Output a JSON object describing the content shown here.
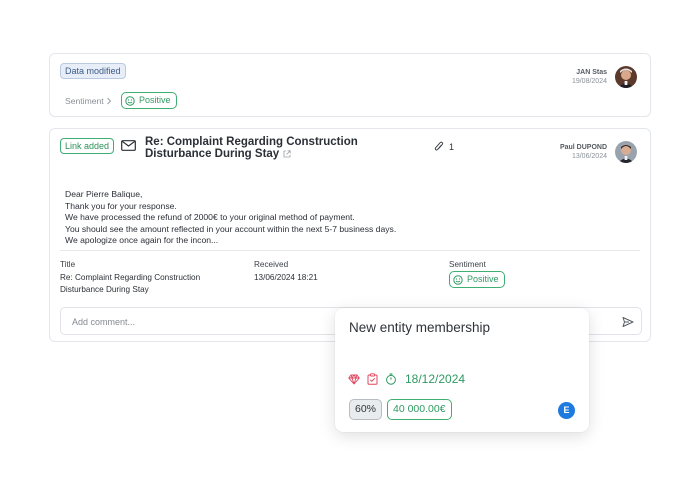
{
  "card1": {
    "tag": "Data modified",
    "sentiment_label": "Sentiment",
    "sentiment_value": "Positive",
    "author_name": "JAN Stas",
    "author_date": "19/08/2024"
  },
  "card2": {
    "tag": "Link added",
    "subject": "Re: Complaint Regarding Construction Disturbance During Stay",
    "attachment_count": "1",
    "author_name": "Paul DUPOND",
    "author_date": "13/06/2024",
    "body_lines": [
      "Dear Pierre Balique,",
      "Thank you for your response.",
      "We have processed the refund of 2000€ to your original method of payment.",
      "You should see the amount reflected in your account within the next 5-7 business days.",
      "We apologize once again for the incon..."
    ],
    "meta": {
      "title_label": "Title",
      "title_value": "Re: Complaint Regarding Construction Disturbance During Stay",
      "received_label": "Received",
      "received_value": "13/06/2024 18:21",
      "sentiment_label": "Sentiment",
      "sentiment_value": "Positive"
    },
    "comment_placeholder": "Add comment..."
  },
  "popup": {
    "title": "New entity membership",
    "date": "18/12/2024",
    "percent": "60%",
    "amount": "40 000.00€",
    "entity_initial": "E"
  },
  "colors": {
    "green": "#2f9a62",
    "blue_tag": "#3e5b86",
    "entity_blue": "#1f7ae0",
    "icon_red": "#e0465c"
  },
  "icons": [
    "chevron-right-icon",
    "smile-icon",
    "mail-icon",
    "external-link-icon",
    "paperclip-icon",
    "send-icon",
    "gem-icon",
    "clipboard-check-icon",
    "timer-icon"
  ]
}
